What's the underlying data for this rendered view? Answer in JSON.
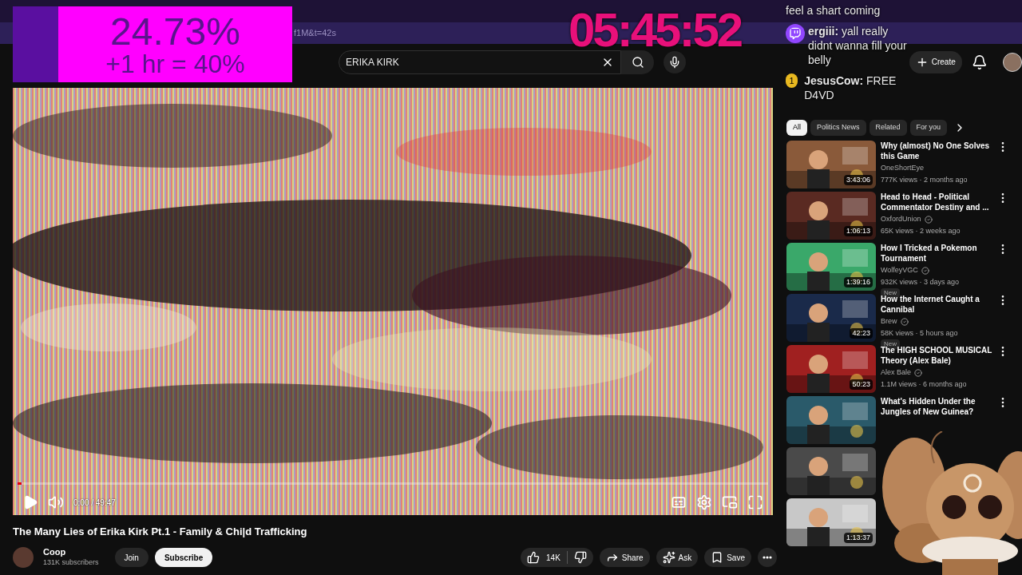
{
  "browser": {
    "url_fragment": "f1M&t=42s"
  },
  "overlay_progress": {
    "percent": "24.73%",
    "projection": "+1 hr = 40%"
  },
  "overlay_timer": "05:45:52",
  "chat": [
    {
      "text": "feel a shart coming",
      "twitch_icon": false
    },
    {
      "user": "ergiii:",
      "text": "yall really didnt wanna fill your belly",
      "twitch_icon": true
    },
    {
      "user": "JesusCow:",
      "text": "FREE D4VD",
      "badge": "1",
      "twitch_icon": false
    }
  ],
  "search": {
    "value": "ERIKA KIRK"
  },
  "header": {
    "create": "Create"
  },
  "player": {
    "time": "0:00 / 49:47",
    "level": 0.005
  },
  "video": {
    "title": "The Many Lies of Erika Kirk Pt.1 - Family & Chi|d Trafficking",
    "channel": "Coop",
    "subscribers": "131K subscribers",
    "join": "Join",
    "subscribe": "Subscribe",
    "likes": "14K",
    "actions": [
      {
        "kind": "share",
        "label": "Share"
      },
      {
        "kind": "ask",
        "label": "Ask"
      },
      {
        "kind": "save",
        "label": "Save"
      }
    ]
  },
  "chips": [
    {
      "label": "All",
      "selected": true
    },
    {
      "label": "Politics News",
      "selected": false
    },
    {
      "label": "Related",
      "selected": false
    },
    {
      "label": "For you",
      "selected": false
    }
  ],
  "recommendations": [
    {
      "title": "Why (almost) No One Solves this Game",
      "channel": "OneShortEye",
      "verified": false,
      "meta": "777K views · 2 months ago",
      "duration": "3:43:06"
    },
    {
      "title": "Head to Head - Political Commentator Destiny and ...",
      "channel": "OxfordUnion",
      "verified": true,
      "meta": "65K views · 2 weeks ago",
      "duration": "1:06:13"
    },
    {
      "title": "How I Tricked a Pokemon Tournament",
      "channel": "WolfeyVGC",
      "verified": true,
      "meta": "932K views · 3 days ago",
      "duration": "1:39:16",
      "badge": "New"
    },
    {
      "title": "How the Internet Caught a Cannibal",
      "channel": "Brew",
      "verified": true,
      "meta": "58K views · 5 hours ago",
      "duration": "42:23",
      "badge": "New"
    },
    {
      "title": "The HIGH SCHOOL MUSICAL Theory (Alex Bale)",
      "channel": "Alex Bale",
      "verified": true,
      "meta": "1.1M views · 6 months ago",
      "duration": "50:23"
    },
    {
      "title": "What's Hidden Under the Jungles of New Guinea?"
    },
    {
      "kind": "picture"
    },
    {
      "duration": "1:13:37"
    }
  ]
}
